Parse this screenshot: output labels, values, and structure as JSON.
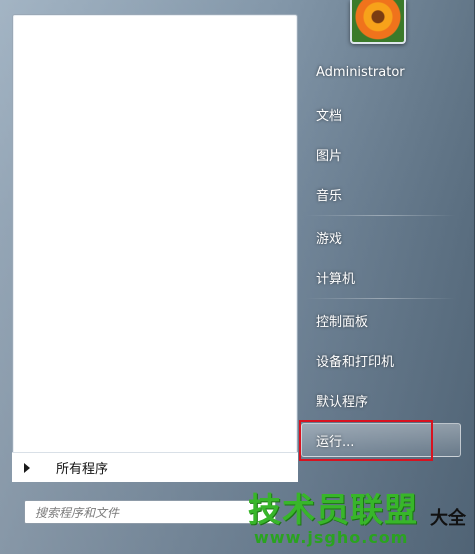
{
  "right_pane": {
    "username": "Administrator",
    "items": [
      {
        "label": "文档"
      },
      {
        "label": "图片"
      },
      {
        "label": "音乐"
      },
      {
        "label": "游戏"
      },
      {
        "label": "计算机"
      },
      {
        "label": "控制面板"
      },
      {
        "label": "设备和打印机"
      },
      {
        "label": "默认程序"
      }
    ],
    "run_label": "运行..."
  },
  "left_pane": {
    "all_programs_label": "所有程序",
    "search_placeholder": "搜索程序和文件"
  },
  "watermark": {
    "title": "技术员联盟",
    "url": "www.jsgho.com",
    "side_text": "大全"
  },
  "colors": {
    "highlight": "#d8121f",
    "watermark": "#38b62a"
  },
  "icons": {
    "all_programs_arrow": "triangle-right",
    "user_picture": "flower-photo",
    "search": "magnifier"
  }
}
